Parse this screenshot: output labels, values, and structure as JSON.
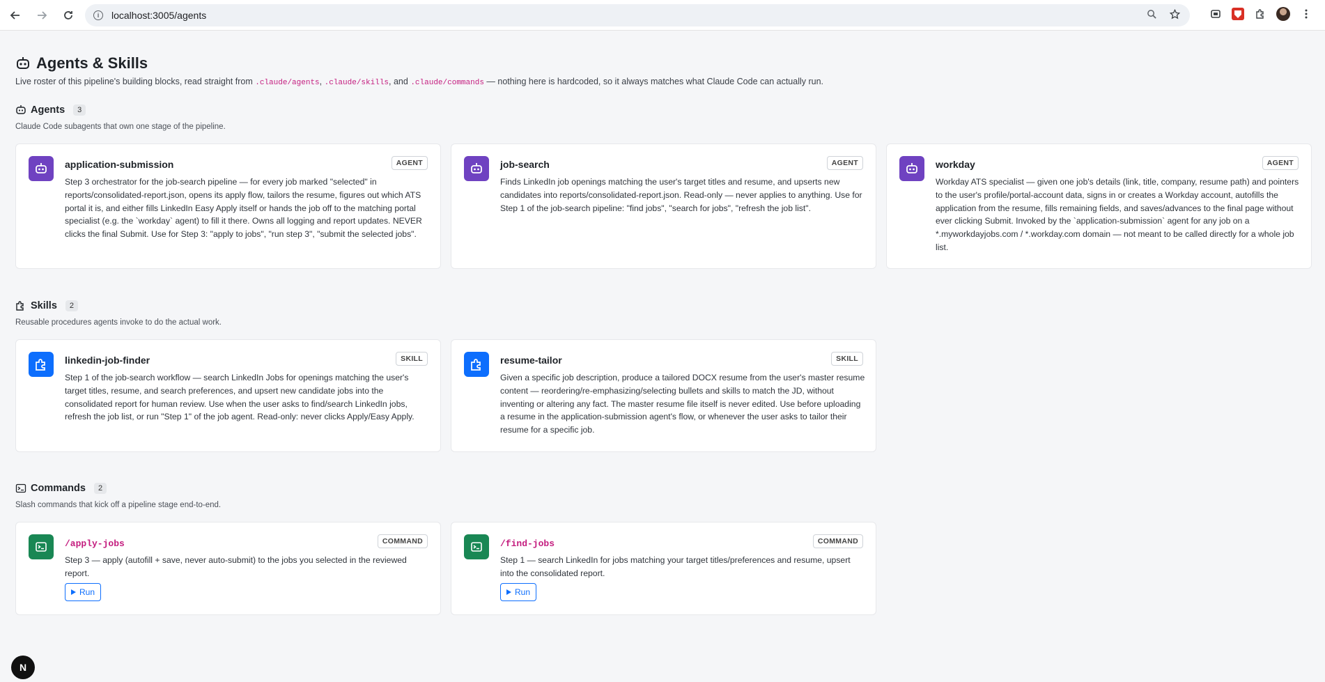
{
  "browser": {
    "url": "localhost:3005/agents"
  },
  "header": {
    "title": "Agents & Skills",
    "subtitle_pre": "Live roster of this pipeline's building blocks, read straight from ",
    "code1": ".claude/agents",
    "sep1": ", ",
    "code2": ".claude/skills",
    "sep2": ", and ",
    "code3": ".claude/commands",
    "subtitle_post": " — nothing here is hardcoded, so it always matches what Claude Code can actually run."
  },
  "agents": {
    "title": "Agents",
    "count": "3",
    "subtitle": "Claude Code subagents that own one stage of the pipeline.",
    "badge": "AGENT",
    "items": [
      {
        "name": "application-submission",
        "desc": "Step 3 orchestrator for the job-search pipeline — for every job marked \"selected\" in reports/consolidated-report.json, opens its apply flow, tailors the resume, figures out which ATS portal it is, and either fills LinkedIn Easy Apply itself or hands the job off to the matching portal specialist (e.g. the `workday` agent) to fill it there. Owns all logging and report updates. NEVER clicks the final Submit. Use for Step 3: \"apply to jobs\", \"run step 3\", \"submit the selected jobs\"."
      },
      {
        "name": "job-search",
        "desc": "Finds LinkedIn job openings matching the user's target titles and resume, and upserts new candidates into reports/consolidated-report.json. Read-only — never applies to anything. Use for Step 1 of the job-search pipeline: \"find jobs\", \"search for jobs\", \"refresh the job list\"."
      },
      {
        "name": "workday",
        "desc": "Workday ATS specialist — given one job's details (link, title, company, resume path) and pointers to the user's profile/portal-account data, signs in or creates a Workday account, autofills the application from the resume, fills remaining fields, and saves/advances to the final page without ever clicking Submit. Invoked by the `application-submission` agent for any job on a *.myworkdayjobs.com / *.workday.com domain — not meant to be called directly for a whole job list."
      }
    ]
  },
  "skills": {
    "title": "Skills",
    "count": "2",
    "subtitle": "Reusable procedures agents invoke to do the actual work.",
    "badge": "SKILL",
    "items": [
      {
        "name": "linkedin-job-finder",
        "desc": "Step 1 of the job-search workflow — search LinkedIn Jobs for openings matching the user's target titles, resume, and search preferences, and upsert new candidate jobs into the consolidated report for human review. Use when the user asks to find/search LinkedIn jobs, refresh the job list, or run \"Step 1\" of the job agent. Read-only: never clicks Apply/Easy Apply."
      },
      {
        "name": "resume-tailor",
        "desc": "Given a specific job description, produce a tailored DOCX resume from the user's master resume content — reordering/re-emphasizing/selecting bullets and skills to match the JD, without inventing or altering any fact. The master resume file itself is never edited. Use before uploading a resume in the application-submission agent's flow, or whenever the user asks to tailor their resume for a specific job."
      }
    ]
  },
  "commands": {
    "title": "Commands",
    "count": "2",
    "subtitle": "Slash commands that kick off a pipeline stage end-to-end.",
    "badge": "COMMAND",
    "run_label": "Run",
    "items": [
      {
        "name": "/apply-jobs",
        "desc": "Step 3 — apply (autofill + save, never auto-submit) to the jobs you selected in the reviewed report."
      },
      {
        "name": "/find-jobs",
        "desc": "Step 1 — search LinkedIn for jobs matching your target titles/preferences and resume, upsert into the consolidated report."
      }
    ]
  },
  "dev_badge": "N"
}
